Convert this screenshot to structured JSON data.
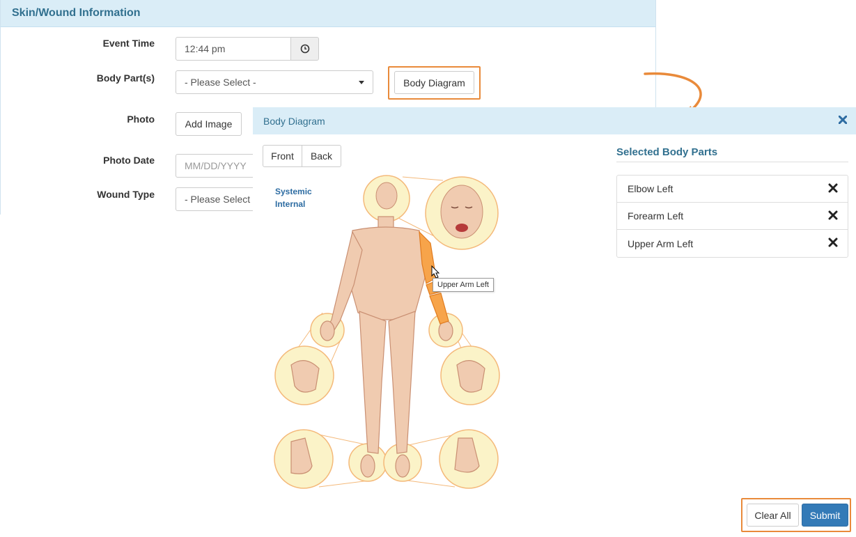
{
  "form": {
    "header": "Skin/Wound Information",
    "event_time_label": "Event Time",
    "event_time_value": "12:44 pm",
    "body_parts_label": "Body Part(s)",
    "body_parts_select": "- Please Select -",
    "body_diagram_button": "Body Diagram",
    "photo_label": "Photo",
    "add_image_button": "Add Image",
    "photo_date_label": "Photo Date",
    "photo_date_placeholder": "MM/DD/YYYY",
    "wound_type_label": "Wound Type",
    "wound_type_select": "- Please Select"
  },
  "modal": {
    "title": "Body Diagram",
    "tabs": [
      "Front",
      "Back"
    ],
    "links": [
      "Systemic",
      "Internal"
    ],
    "tooltip": "Upper Arm Left",
    "selected_title": "Selected Body Parts",
    "selected_parts": [
      "Elbow Left",
      "Forearm Left",
      "Upper Arm Left"
    ],
    "clear_all_button": "Clear All",
    "submit_button": "Submit"
  },
  "colors": {
    "accent_header_bg": "#daedf7",
    "header_text": "#31708f",
    "highlight_orange": "#e98a3a",
    "selected_part": "#f7a44a",
    "skin": "#f0cbb0",
    "zoom_circle": "#fbf3c8",
    "submit_bg": "#337ab7"
  },
  "icons": [
    "clock-icon",
    "chevron-down-icon",
    "close-icon",
    "remove-icon",
    "pointer-cursor-icon",
    "arrow-icon"
  ]
}
